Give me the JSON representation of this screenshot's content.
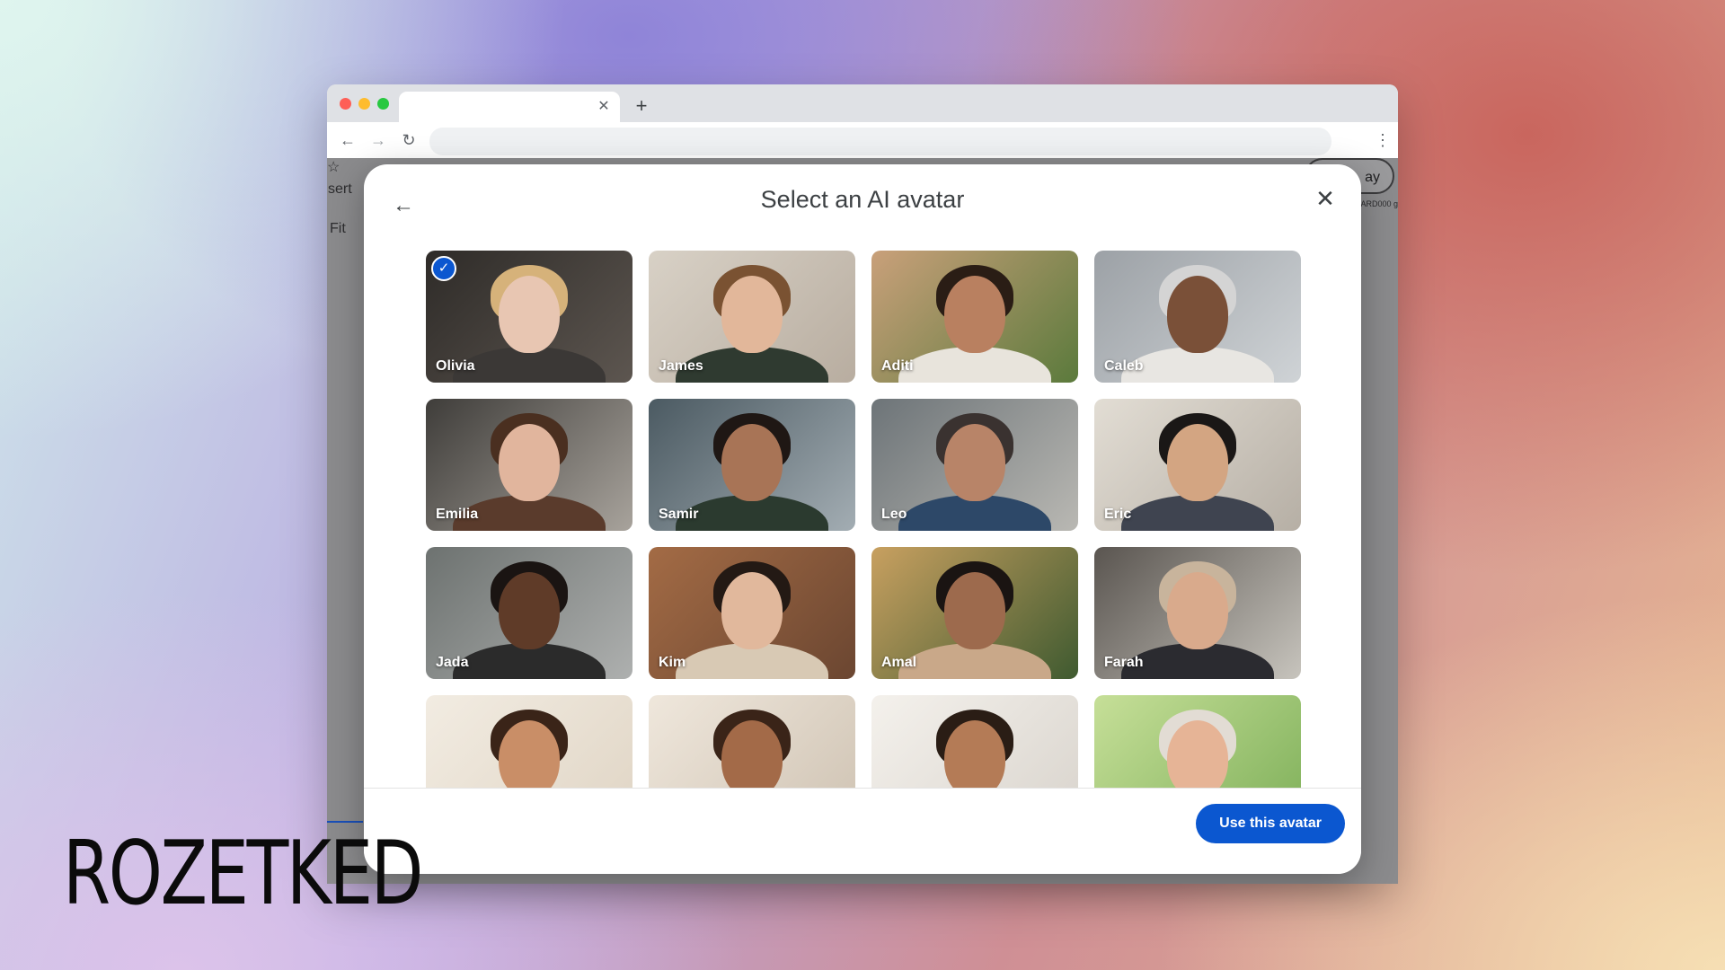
{
  "browser": {
    "tab": {
      "close_icon": "close-icon",
      "new_tab_icon": "plus-icon"
    },
    "address_bar": {
      "value": ""
    }
  },
  "background_page": {
    "insert_label": "sert",
    "fit_label": "Fit",
    "right_button_label": "ay",
    "right_small_text": "ARD000 g"
  },
  "modal": {
    "title": "Select an AI avatar",
    "back_icon": "arrow-left-icon",
    "close_icon": "close-icon",
    "primary_button": "Use this avatar",
    "avatars": [
      {
        "name": "Olivia",
        "selected": true,
        "bg": "#5d5650",
        "bg2": "#2e2b28",
        "skin": "#e8c6b2",
        "hair": "#d6b27a",
        "shirt": "#3b3836"
      },
      {
        "name": "James",
        "selected": false,
        "bg": "#b8ada0",
        "bg2": "#d8d1c6",
        "skin": "#e2b79a",
        "hair": "#7a5232",
        "shirt": "#2f3a30"
      },
      {
        "name": "Aditi",
        "selected": false,
        "bg": "#5b7a3c",
        "bg2": "#c9a07a",
        "skin": "#b98060",
        "hair": "#2a1d15",
        "shirt": "#e8e4dc"
      },
      {
        "name": "Caleb",
        "selected": false,
        "bg": "#cfd3d6",
        "bg2": "#9ca1a6",
        "skin": "#7a5038",
        "hair": "#d4d4d4",
        "shirt": "#e8e6e2"
      },
      {
        "name": "Emilia",
        "selected": false,
        "bg": "#a8a39c",
        "bg2": "#3f3d3a",
        "skin": "#e1b59d",
        "hair": "#4a2f20",
        "shirt": "#5a3b2c"
      },
      {
        "name": "Samir",
        "selected": false,
        "bg": "#a3adb3",
        "bg2": "#4b5a62",
        "skin": "#a87456",
        "hair": "#1f1714",
        "shirt": "#2b3a2f"
      },
      {
        "name": "Leo",
        "selected": false,
        "bg": "#b9b8b3",
        "bg2": "#6d7478",
        "skin": "#b88468",
        "hair": "#3a3230",
        "shirt": "#2d4868"
      },
      {
        "name": "Eric",
        "selected": false,
        "bg": "#b6afa5",
        "bg2": "#e2ddd4",
        "skin": "#d3a582",
        "hair": "#1a1716",
        "shirt": "#3f4450"
      },
      {
        "name": "Jada",
        "selected": false,
        "bg": "#aeb0af",
        "bg2": "#6d7270",
        "skin": "#5f3b28",
        "hair": "#1a1412",
        "shirt": "#2b2b2b"
      },
      {
        "name": "Kim",
        "selected": false,
        "bg": "#6b4631",
        "bg2": "#a36b45",
        "skin": "#e1b89c",
        "hair": "#231914",
        "shirt": "#d8c9b4"
      },
      {
        "name": "Amal",
        "selected": false,
        "bg": "#3f5a30",
        "bg2": "#c8a060",
        "skin": "#9d6a4d",
        "hair": "#1a1412",
        "shirt": "#c9a889"
      },
      {
        "name": "Farah",
        "selected": false,
        "bg": "#c7c4bd",
        "bg2": "#5a5550",
        "skin": "#d9aa8c",
        "hair": "#c8b49c",
        "shirt": "#2b2b30"
      },
      {
        "name": "",
        "selected": false,
        "bg": "#e0d5c5",
        "bg2": "#f2ece2",
        "skin": "#c98e67",
        "hair": "#3a2418",
        "shirt": "#e7ddd0"
      },
      {
        "name": "",
        "selected": false,
        "bg": "#cfc3b3",
        "bg2": "#efe7dc",
        "skin": "#a36a48",
        "hair": "#3a2418",
        "shirt": "#efe7dc"
      },
      {
        "name": "",
        "selected": false,
        "bg": "#d9d4cd",
        "bg2": "#f4f1ec",
        "skin": "#b47b56",
        "hair": "#2a1d15",
        "shirt": "#ede8e0"
      },
      {
        "name": "",
        "selected": false,
        "bg": "#7fb05a",
        "bg2": "#c6df98",
        "skin": "#e6b496",
        "hair": "#e2dcd4",
        "shirt": "#8fa860"
      }
    ]
  },
  "watermark": {
    "text": "ROZETKED"
  }
}
